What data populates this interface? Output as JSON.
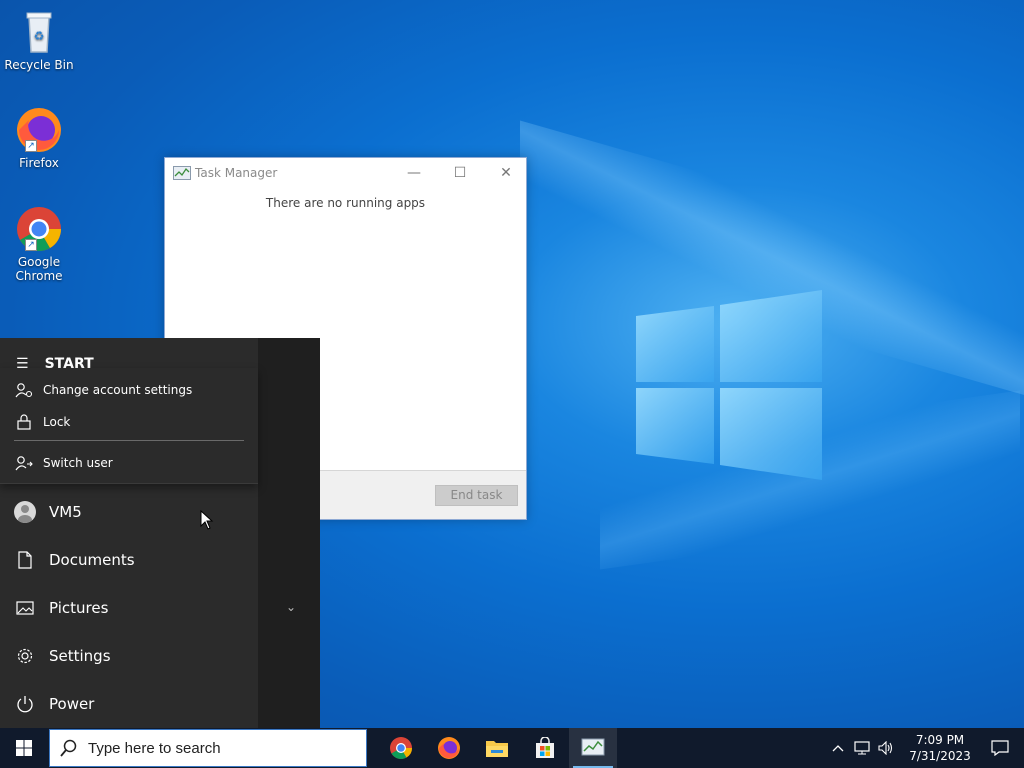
{
  "desktop": {
    "icons": [
      {
        "label": "Recycle Bin",
        "icon": "recycle-bin-icon"
      },
      {
        "label": "Firefox",
        "icon": "firefox-icon"
      },
      {
        "label": "Google Chrome",
        "icon": "chrome-icon"
      }
    ]
  },
  "task_manager": {
    "title": "Task Manager",
    "message": "There are no running apps",
    "end_task_label": "End task",
    "minimize_glyph": "—",
    "maximize_glyph": "☐",
    "close_glyph": "✕"
  },
  "start_menu": {
    "header": "START",
    "account_menu": [
      {
        "label": "Change account settings",
        "icon": "account-settings-icon"
      },
      {
        "label": "Lock",
        "icon": "lock-icon"
      },
      {
        "label": "Switch user",
        "icon": "switch-user-icon"
      }
    ],
    "items": [
      {
        "label": "VM5",
        "icon": "user-avatar-icon"
      },
      {
        "label": "Documents",
        "icon": "document-icon"
      },
      {
        "label": "Pictures",
        "icon": "pictures-icon"
      },
      {
        "label": "Settings",
        "icon": "gear-icon"
      },
      {
        "label": "Power",
        "icon": "power-icon"
      }
    ]
  },
  "taskbar": {
    "search_placeholder": "Type here to search",
    "pinned_apps": [
      "chrome-icon",
      "firefox-icon",
      "file-explorer-icon",
      "store-icon",
      "task-manager-icon"
    ],
    "clock_time": "7:09 PM",
    "clock_date": "7/31/2023"
  },
  "colors": {
    "desktop_blue": "#0b6fd0",
    "taskbar": "#101a2c",
    "start_menu": "#2b2b2b",
    "active_indicator": "#76b9ed"
  }
}
